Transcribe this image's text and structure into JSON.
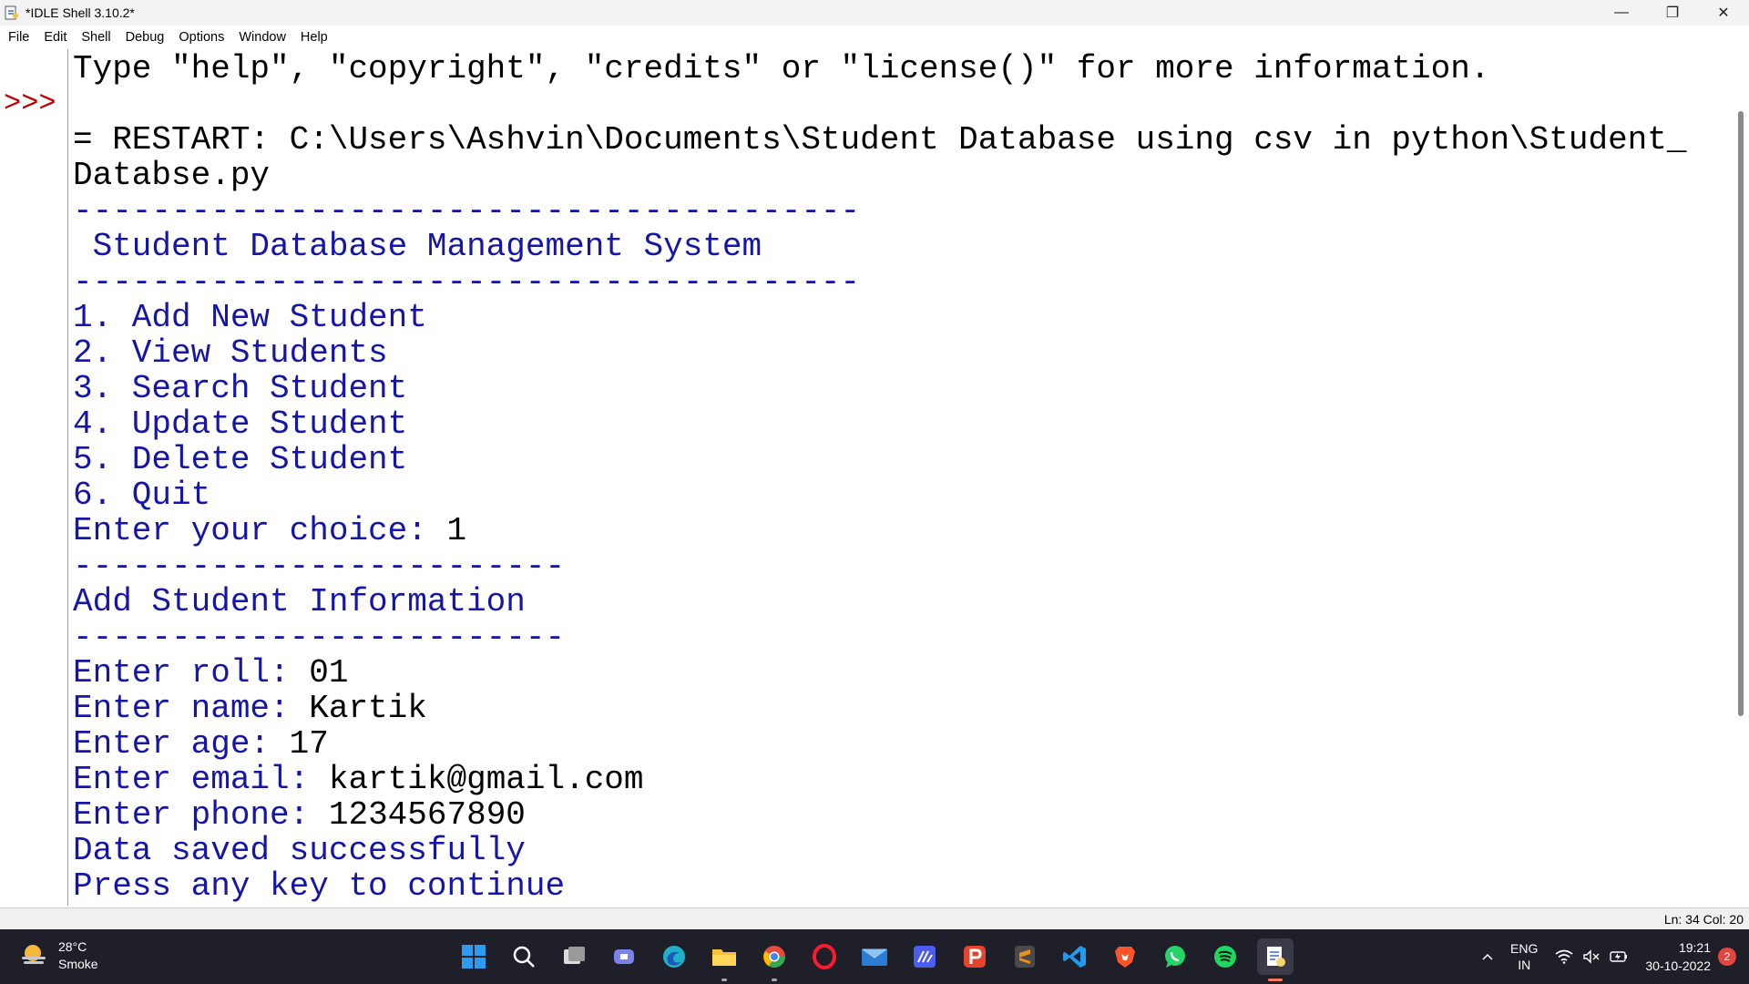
{
  "window": {
    "title": "*IDLE Shell 3.10.2*",
    "minimize": "—",
    "restore": "❐",
    "close": "✕"
  },
  "menu": [
    "File",
    "Edit",
    "Shell",
    "Debug",
    "Options",
    "Window",
    "Help"
  ],
  "shell": {
    "prompt": ">>>",
    "lines": [
      {
        "text": "Type \"help\", \"copyright\", \"credits\" or \"license()\" for more information.",
        "color": "black"
      },
      {
        "text": "",
        "color": "black"
      },
      {
        "text": "= RESTART: C:\\Users\\Ashvin\\Documents\\Student Database using csv in python\\Student_",
        "color": "black"
      },
      {
        "text": "Databse.py",
        "color": "black"
      },
      {
        "text": "----------------------------------------",
        "color": "blue"
      },
      {
        "text": " Student Database Management System",
        "color": "blue"
      },
      {
        "text": "----------------------------------------",
        "color": "blue"
      },
      {
        "text": "1. Add New Student",
        "color": "blue"
      },
      {
        "text": "2. View Students",
        "color": "blue"
      },
      {
        "text": "3. Search Student",
        "color": "blue"
      },
      {
        "text": "4. Update Student",
        "color": "blue"
      },
      {
        "text": "5. Delete Student",
        "color": "blue"
      },
      {
        "text": "6. Quit",
        "color": "blue"
      },
      {
        "prompt": "Enter your choice: ",
        "input": "1"
      },
      {
        "text": "-------------------------",
        "color": "blue"
      },
      {
        "text": "Add Student Information",
        "color": "blue"
      },
      {
        "text": "-------------------------",
        "color": "blue"
      },
      {
        "prompt": "Enter roll: ",
        "input": "01"
      },
      {
        "prompt": "Enter name: ",
        "input": "Kartik"
      },
      {
        "prompt": "Enter age: ",
        "input": "17"
      },
      {
        "prompt": "Enter email: ",
        "input": "kartik@gmail.com"
      },
      {
        "prompt": "Enter phone: ",
        "input": "1234567890"
      },
      {
        "text": "Data saved successfully",
        "color": "blue"
      },
      {
        "text": "Press any key to continue",
        "color": "blue"
      }
    ]
  },
  "status": {
    "position": "Ln: 34   Col: 20"
  },
  "taskbar": {
    "weather": {
      "temp": "28°C",
      "condition": "Smoke",
      "icon": "weather-haze-icon"
    },
    "apps": [
      {
        "name": "start-icon",
        "color": "#2f9bf0"
      },
      {
        "name": "search-icon",
        "color": "#ffffff"
      },
      {
        "name": "task-view-icon",
        "color": "#ffffff"
      },
      {
        "name": "teams-chat-icon",
        "color": "#7b83eb"
      },
      {
        "name": "edge-icon",
        "color": "#1fb0c8"
      },
      {
        "name": "file-explorer-icon",
        "color": "#f5c13a"
      },
      {
        "name": "chrome-icon",
        "color": "#e84a3c"
      },
      {
        "name": "opera-icon",
        "color": "#ff1b2d"
      },
      {
        "name": "mail-icon",
        "color": "#2b7cd3"
      },
      {
        "name": "code-editor-icon",
        "color": "#4c5cf0"
      },
      {
        "name": "pdf-icon",
        "color": "#e2452b"
      },
      {
        "name": "sublime-icon",
        "color": "#f08c1a"
      },
      {
        "name": "vscode-icon",
        "color": "#1f9cf0"
      },
      {
        "name": "brave-icon",
        "color": "#fb542b"
      },
      {
        "name": "whatsapp-icon",
        "color": "#25d366"
      },
      {
        "name": "spotify-icon",
        "color": "#1ed760"
      },
      {
        "name": "idle-icon",
        "color": "#f5d76e"
      }
    ],
    "tray": {
      "lang_top": "ENG",
      "lang_bottom": "IN",
      "time": "19:21",
      "date": "30-10-2022",
      "notifications": "2"
    }
  },
  "colors": {
    "prompt": "#c00000",
    "output": "#1515a8",
    "input": "#000000"
  }
}
